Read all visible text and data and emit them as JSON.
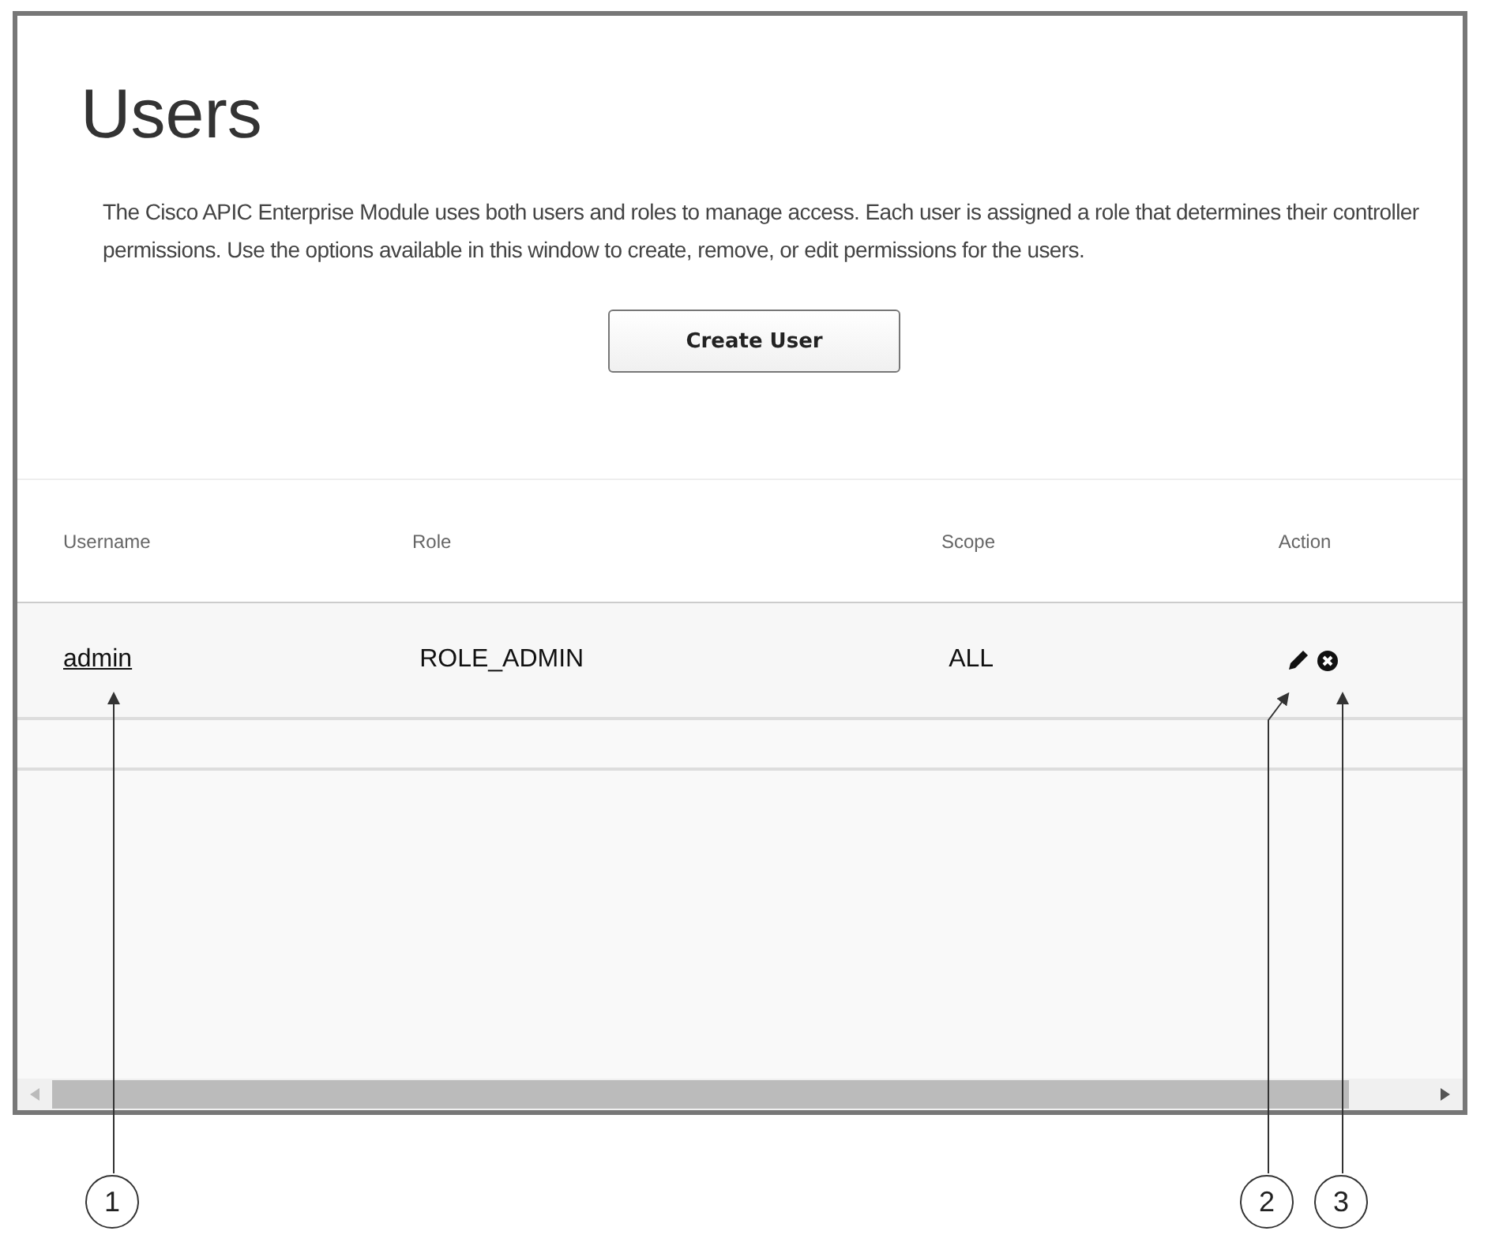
{
  "page": {
    "title": "Users",
    "description": "The Cisco APIC Enterprise Module uses both users and roles to manage access. Each user is assigned a role that determines their controller permissions. Use the options available in this window to create, remove, or edit permissions for the users.",
    "create_button": "Create User"
  },
  "table": {
    "columns": [
      "Username",
      "Role",
      "Scope",
      "Action"
    ],
    "rows": [
      {
        "username": "admin",
        "role": "ROLE_ADMIN",
        "scope": "ALL"
      }
    ]
  },
  "callouts": [
    "1",
    "2",
    "3"
  ]
}
